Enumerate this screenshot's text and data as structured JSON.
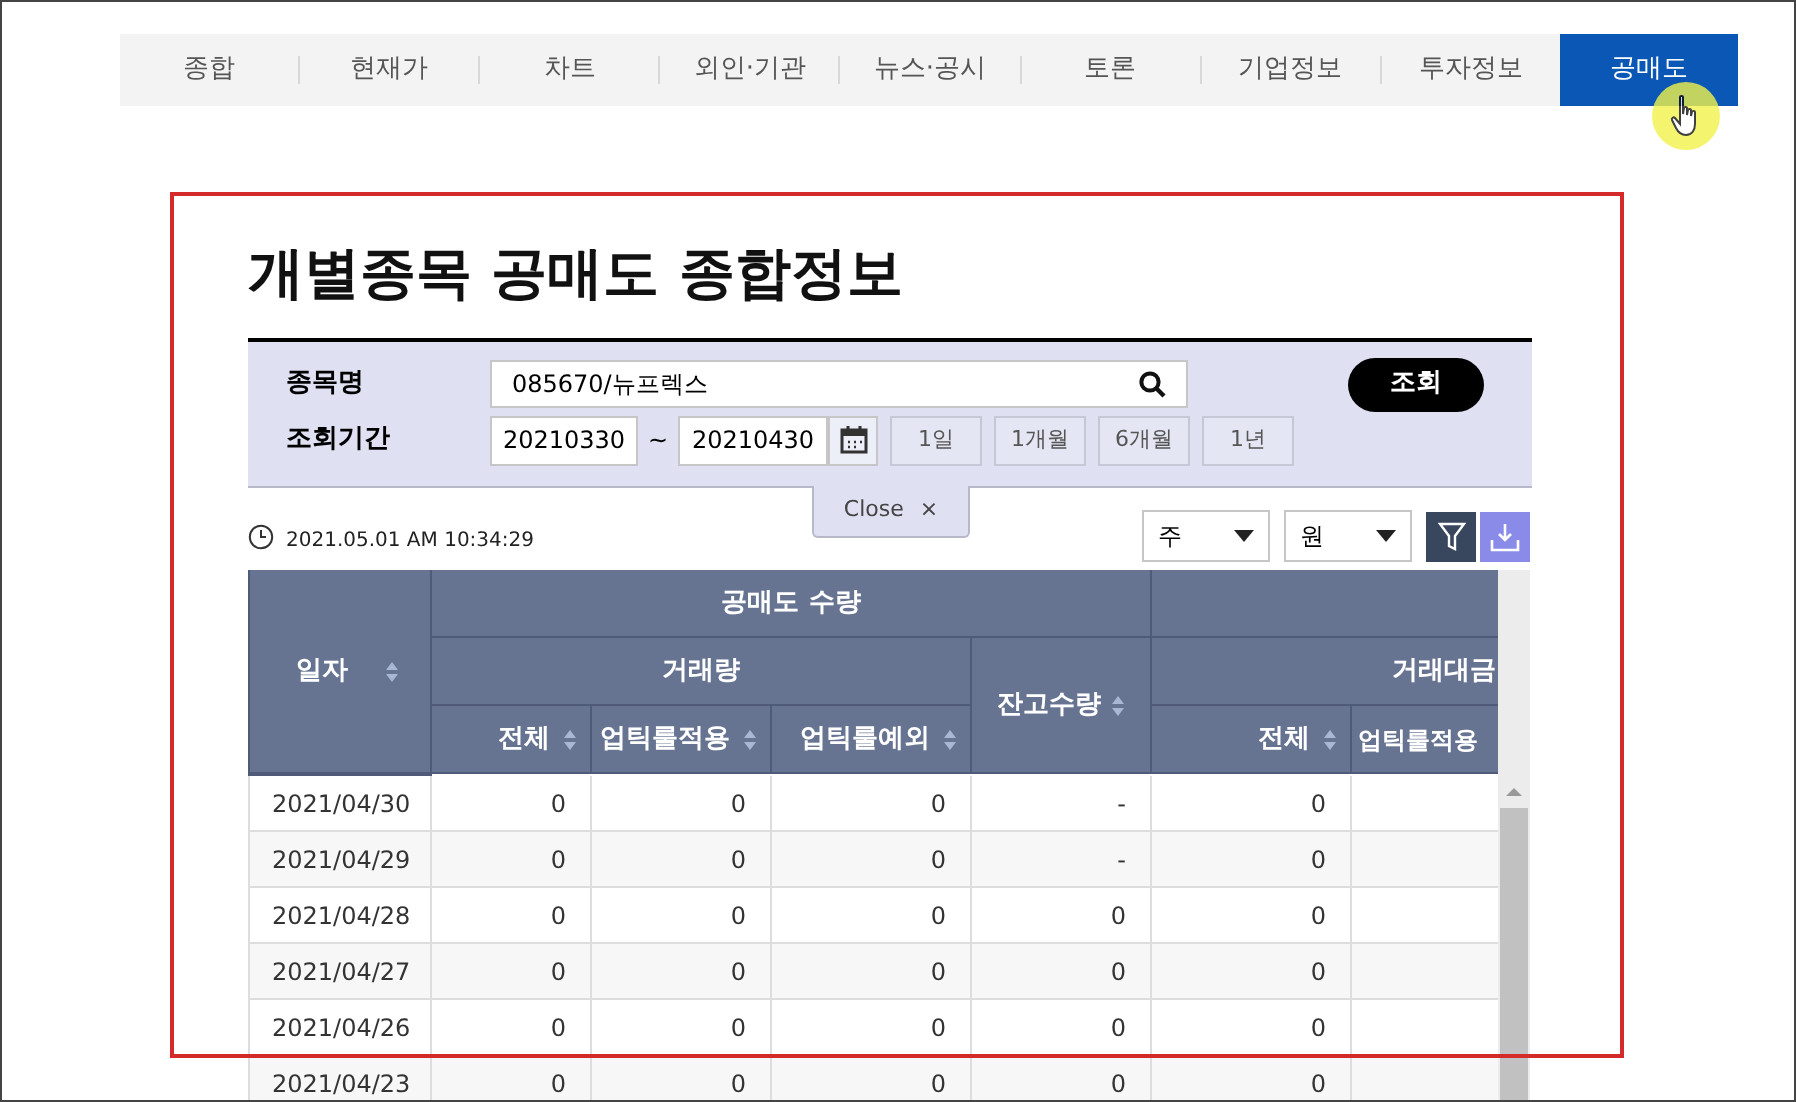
{
  "nav_tabs": [
    {
      "label": "종합",
      "selected": false
    },
    {
      "label": "현재가",
      "selected": false
    },
    {
      "label": "차트",
      "selected": false
    },
    {
      "label": "외인·기관",
      "selected": false
    },
    {
      "label": "뉴스·공시",
      "selected": false
    },
    {
      "label": "토론",
      "selected": false
    },
    {
      "label": "기업정보",
      "selected": false
    },
    {
      "label": "투자정보",
      "selected": false
    },
    {
      "label": "공매도",
      "selected": true
    }
  ],
  "title": "개별종목 공매도 종합정보",
  "search_panel": {
    "stock_label": "종목명",
    "stock_value": "085670/뉴프렉스",
    "period_label": "조회기간",
    "date_from": "20210330",
    "date_separator": "~",
    "date_to": "20210430",
    "period_buttons": [
      "1일",
      "1개월",
      "6개월",
      "1년"
    ],
    "search_button": "조회",
    "close_tab": {
      "label": "Close",
      "icon": "×"
    }
  },
  "timestamp": "2021.05.01 AM 10:34:29",
  "selects": [
    {
      "value": "주"
    },
    {
      "value": "원"
    }
  ],
  "table": {
    "group_headers": [
      "공매도 수량"
    ],
    "sub_headers": [
      "거래량",
      "잔고수량",
      "거래대금"
    ],
    "date_column": "일자",
    "columns": [
      "전체",
      "업틱룰적용",
      "업틱룰예외",
      "전체",
      "업틱룰적용"
    ],
    "rows": [
      {
        "date": "2021/04/30",
        "cells": [
          "0",
          "0",
          "0",
          "-",
          "0"
        ]
      },
      {
        "date": "2021/04/29",
        "cells": [
          "0",
          "0",
          "0",
          "-",
          "0"
        ]
      },
      {
        "date": "2021/04/28",
        "cells": [
          "0",
          "0",
          "0",
          "0",
          "0"
        ]
      },
      {
        "date": "2021/04/27",
        "cells": [
          "0",
          "0",
          "0",
          "0",
          "0"
        ]
      },
      {
        "date": "2021/04/26",
        "cells": [
          "0",
          "0",
          "0",
          "0",
          "0"
        ]
      },
      {
        "date": "2021/04/23",
        "cells": [
          "0",
          "0",
          "0",
          "0",
          "0"
        ]
      }
    ]
  }
}
